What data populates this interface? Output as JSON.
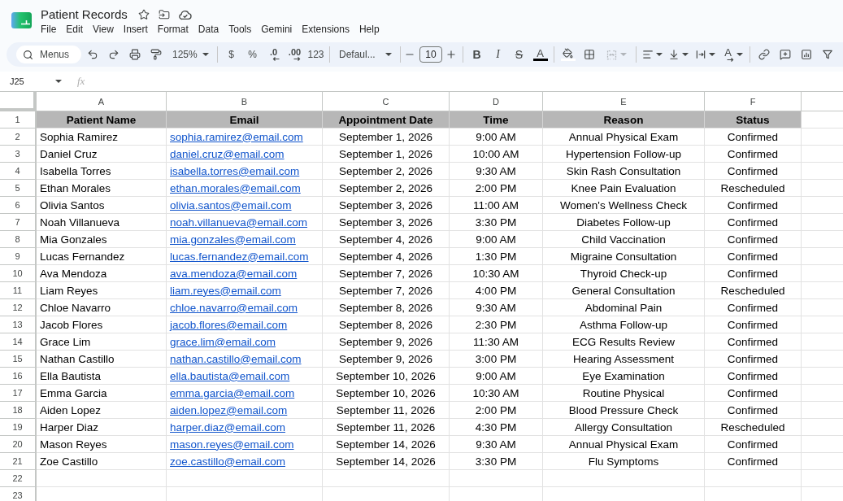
{
  "document": {
    "title": "Patient Records"
  },
  "menu": [
    "File",
    "Edit",
    "View",
    "Insert",
    "Format",
    "Data",
    "Tools",
    "Gemini",
    "Extensions",
    "Help"
  ],
  "toolbar": {
    "search": {
      "placeholder": "Menus"
    },
    "zoom": "125%",
    "currency": "$",
    "percent": "%",
    "decrease_decimal": ".0",
    "increase_decimal": ".00",
    "more_formats": "123",
    "font": "Defaul...",
    "font_size": "10",
    "bold": "B",
    "italic": "I",
    "strikethrough": "S",
    "text_color": "A",
    "text_rotation": "A",
    "merge": {
      "disabled": true
    }
  },
  "formula_bar": {
    "name_box": "J25",
    "function_label": "fx"
  },
  "sheet": {
    "column_letters": [
      "A",
      "B",
      "C",
      "D",
      "E",
      "F"
    ],
    "rows": [
      {
        "number": "1",
        "kind": "header",
        "cells": [
          "Patient Name",
          "Email",
          "Appointment Date",
          "Time",
          "Reason",
          "Status"
        ]
      },
      {
        "number": "2",
        "kind": "record",
        "cells": [
          "Sophia Ramirez",
          "sophia.ramirez@email.com",
          "September 1, 2026",
          "9:00 AM",
          "Annual Physical Exam",
          "Confirmed"
        ]
      },
      {
        "number": "3",
        "kind": "record",
        "cells": [
          "Daniel Cruz",
          "daniel.cruz@email.com",
          "September 1, 2026",
          "10:00 AM",
          "Hypertension Follow-up",
          "Confirmed"
        ]
      },
      {
        "number": "4",
        "kind": "record",
        "cells": [
          "Isabella Torres",
          "isabella.torres@email.com",
          "September 2, 2026",
          "9:30 AM",
          "Skin Rash Consultation",
          "Confirmed"
        ]
      },
      {
        "number": "5",
        "kind": "record",
        "cells": [
          "Ethan Morales",
          "ethan.morales@email.com",
          "September 2, 2026",
          "2:00 PM",
          "Knee Pain Evaluation",
          "Rescheduled"
        ]
      },
      {
        "number": "6",
        "kind": "record",
        "cells": [
          "Olivia Santos",
          "olivia.santos@email.com",
          "September 3, 2026",
          "11:00 AM",
          "Women's Wellness Check",
          "Confirmed"
        ]
      },
      {
        "number": "7",
        "kind": "record",
        "cells": [
          "Noah Villanueva",
          "noah.villanueva@email.com",
          "September 3, 2026",
          "3:30 PM",
          "Diabetes Follow-up",
          "Confirmed"
        ]
      },
      {
        "number": "8",
        "kind": "record",
        "cells": [
          "Mia Gonzales",
          "mia.gonzales@email.com",
          "September 4, 2026",
          "9:00 AM",
          "Child Vaccination",
          "Confirmed"
        ]
      },
      {
        "number": "9",
        "kind": "record",
        "cells": [
          "Lucas Fernandez",
          "lucas.fernandez@email.com",
          "September 4, 2026",
          "1:30 PM",
          "Migraine Consultation",
          "Confirmed"
        ]
      },
      {
        "number": "10",
        "kind": "record",
        "cells": [
          "Ava Mendoza",
          "ava.mendoza@email.com",
          "September 7, 2026",
          "10:30 AM",
          "Thyroid Check-up",
          "Confirmed"
        ]
      },
      {
        "number": "11",
        "kind": "record",
        "cells": [
          "Liam Reyes",
          "liam.reyes@email.com",
          "September 7, 2026",
          "4:00 PM",
          "General Consultation",
          "Rescheduled"
        ]
      },
      {
        "number": "12",
        "kind": "record",
        "cells": [
          "Chloe Navarro",
          "chloe.navarro@email.com",
          "September 8, 2026",
          "9:30 AM",
          "Abdominal Pain",
          "Confirmed"
        ]
      },
      {
        "number": "13",
        "kind": "record",
        "cells": [
          "Jacob Flores",
          "jacob.flores@email.com",
          "September 8, 2026",
          "2:30 PM",
          "Asthma Follow-up",
          "Confirmed"
        ]
      },
      {
        "number": "14",
        "kind": "record",
        "cells": [
          "Grace Lim",
          "grace.lim@email.com",
          "September 9, 2026",
          "11:30 AM",
          "ECG Results Review",
          "Confirmed"
        ]
      },
      {
        "number": "15",
        "kind": "record",
        "cells": [
          "Nathan Castillo",
          "nathan.castillo@email.com",
          "September 9, 2026",
          "3:00 PM",
          "Hearing Assessment",
          "Confirmed"
        ]
      },
      {
        "number": "16",
        "kind": "record",
        "cells": [
          "Ella Bautista",
          "ella.bautista@email.com",
          "September 10, 2026",
          "9:00 AM",
          "Eye Examination",
          "Confirmed"
        ]
      },
      {
        "number": "17",
        "kind": "record",
        "cells": [
          "Emma Garcia",
          "emma.garcia@email.com",
          "September 10, 2026",
          "10:30 AM",
          "Routine Physical",
          "Confirmed"
        ]
      },
      {
        "number": "18",
        "kind": "record",
        "cells": [
          "Aiden Lopez",
          "aiden.lopez@email.com",
          "September 11, 2026",
          "2:00 PM",
          "Blood Pressure Check",
          "Confirmed"
        ]
      },
      {
        "number": "19",
        "kind": "record",
        "cells": [
          "Harper Diaz",
          "harper.diaz@email.com",
          "September 11, 2026",
          "4:30 PM",
          "Allergy Consultation",
          "Rescheduled"
        ]
      },
      {
        "number": "20",
        "kind": "record",
        "cells": [
          "Mason Reyes",
          "mason.reyes@email.com",
          "September 14, 2026",
          "9:30 AM",
          "Annual Physical Exam",
          "Confirmed"
        ]
      },
      {
        "number": "21",
        "kind": "record",
        "cells": [
          "Zoe Castillo",
          "zoe.castillo@email.com",
          "September 14, 2026",
          "3:30 PM",
          "Flu Symptoms",
          "Confirmed"
        ]
      },
      {
        "number": "22",
        "kind": "empty"
      },
      {
        "number": "23",
        "kind": "empty"
      }
    ]
  }
}
